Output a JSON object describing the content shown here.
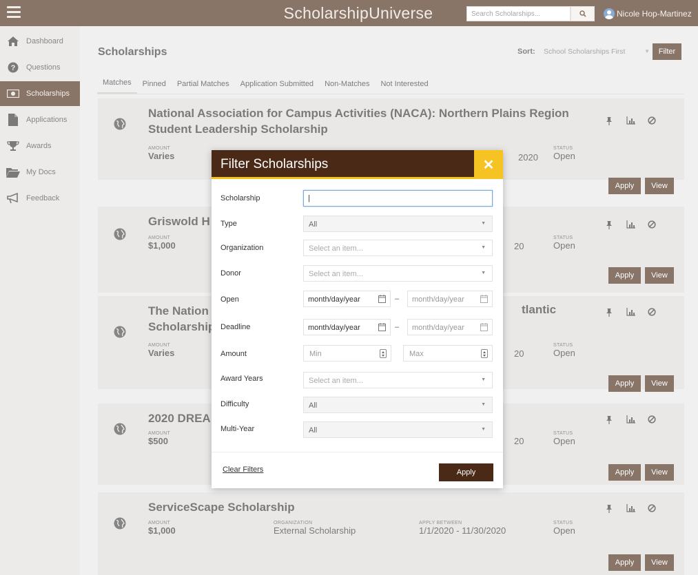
{
  "header": {
    "brand": "ScholarshipUniverse",
    "search_placeholder": "Search Scholarships...",
    "user_name": "Nicole Hop-Martinez"
  },
  "sidebar": {
    "items": [
      {
        "label": "Dashboard",
        "icon": "home-icon"
      },
      {
        "label": "Questions",
        "icon": "question-icon"
      },
      {
        "label": "Scholarships",
        "icon": "money-icon",
        "active": true
      },
      {
        "label": "Applications",
        "icon": "document-icon"
      },
      {
        "label": "Awards",
        "icon": "trophy-icon"
      },
      {
        "label": "My Docs",
        "icon": "folder-icon"
      },
      {
        "label": "Feedback",
        "icon": "megaphone-icon"
      }
    ]
  },
  "main": {
    "title": "Scholarships",
    "sort_label": "Sort:",
    "sort_value": "School Scholarships First",
    "filter_label": "Filter",
    "tabs": [
      "Matches",
      "Pinned",
      "Partial Matches",
      "Application Submitted",
      "Non-Matches",
      "Not Interested"
    ],
    "labels": {
      "amount": "AMOUNT",
      "organization": "ORGANIZATION",
      "apply_between": "APPLY BETWEEN",
      "status": "STATUS"
    },
    "apply_label": "Apply",
    "view_label": "View",
    "cards": [
      {
        "title_line1": "National Association for Campus Activities (NACA): Northern Plains Region",
        "title_line2": "Student Leadership Scholarship",
        "amount": "Varies",
        "apply_between_tail": "2020",
        "status": "Open"
      },
      {
        "title_line1": "Griswold H",
        "amount": "$1,000",
        "title_tail": "",
        "apply_between_tail": "20",
        "status": "Open"
      },
      {
        "title_line1": "The Nation",
        "title_line2": "Scholarship",
        "title_tail": "tlantic",
        "amount": "Varies",
        "apply_between_tail": "20",
        "status": "Open"
      },
      {
        "title_line1": "2020 DREA",
        "amount": "$500",
        "apply_between_tail": "20",
        "status": "Open"
      },
      {
        "title_line1": "ServiceScape Scholarship",
        "amount": "$1,000",
        "organization": "External Scholarship",
        "apply_between": "1/1/2020 - 11/30/2020",
        "status": "Open"
      }
    ]
  },
  "modal": {
    "title": "Filter Scholarships",
    "close_symbol": "✕",
    "fields": {
      "scholarship": {
        "label": "Scholarship",
        "value": "|"
      },
      "type": {
        "label": "Type",
        "value": "All"
      },
      "organization": {
        "label": "Organization",
        "placeholder": "Select an item..."
      },
      "donor": {
        "label": "Donor",
        "placeholder": "Select an item..."
      },
      "open": {
        "label": "Open",
        "from": "month/day/year",
        "to": "month/day/year"
      },
      "deadline": {
        "label": "Deadline",
        "from": "month/day/year",
        "to": "month/day/year"
      },
      "amount": {
        "label": "Amount",
        "min": "Min",
        "max": "Max"
      },
      "award_years": {
        "label": "Award Years",
        "placeholder": "Select an item..."
      },
      "difficulty": {
        "label": "Difficulty",
        "value": "All"
      },
      "multi_year": {
        "label": "Multi-Year",
        "value": "All"
      }
    },
    "dash": "–",
    "clear_label": "Clear Filters",
    "apply_label": "Apply"
  }
}
